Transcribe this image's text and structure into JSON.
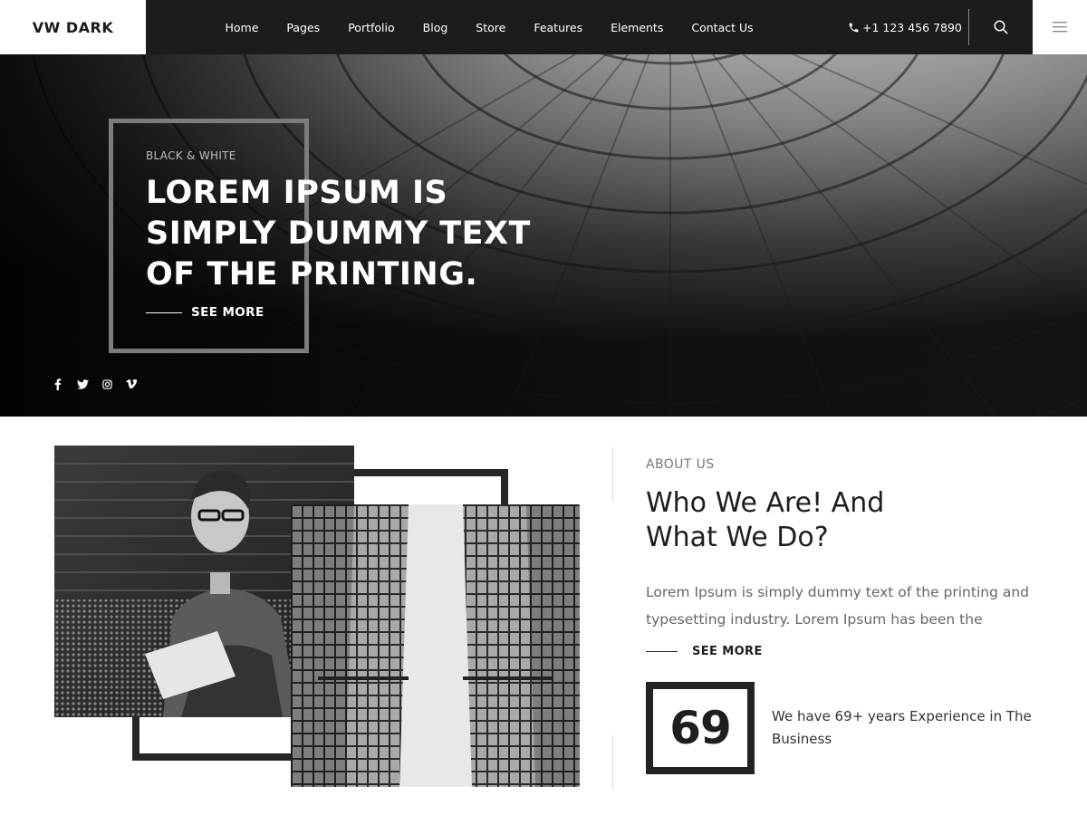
{
  "header": {
    "logo": "VW DARK",
    "nav": [
      "Home",
      "Pages",
      "Portfolio",
      "Blog",
      "Store",
      "Features",
      "Elements",
      "Contact Us"
    ],
    "phone": "+1 123 456 7890",
    "icons": {
      "phone": "phone-icon",
      "search": "search-icon",
      "menu": "hamburger-menu-icon"
    }
  },
  "hero": {
    "kicker": "BLACK & WHITE",
    "title": "LOREM IPSUM IS SIMPLY DUMMY TEXT OF THE PRINTING.",
    "cta": "SEE MORE",
    "socials": [
      "facebook-icon",
      "twitter-icon",
      "instagram-icon",
      "vimeo-icon"
    ]
  },
  "about": {
    "kicker": "ABOUT US",
    "title": "Who We Are! And What We Do?",
    "text": "Lorem Ipsum is simply dummy text of the printing and typesetting industry. Lorem Ipsum has been the",
    "cta": "SEE MORE",
    "years": "69",
    "years_text": "We have 69+ years Experience in The Business"
  },
  "colors": {
    "header_bg": "#1c1c1c",
    "accent": "#222222",
    "text_muted": "#666666"
  }
}
